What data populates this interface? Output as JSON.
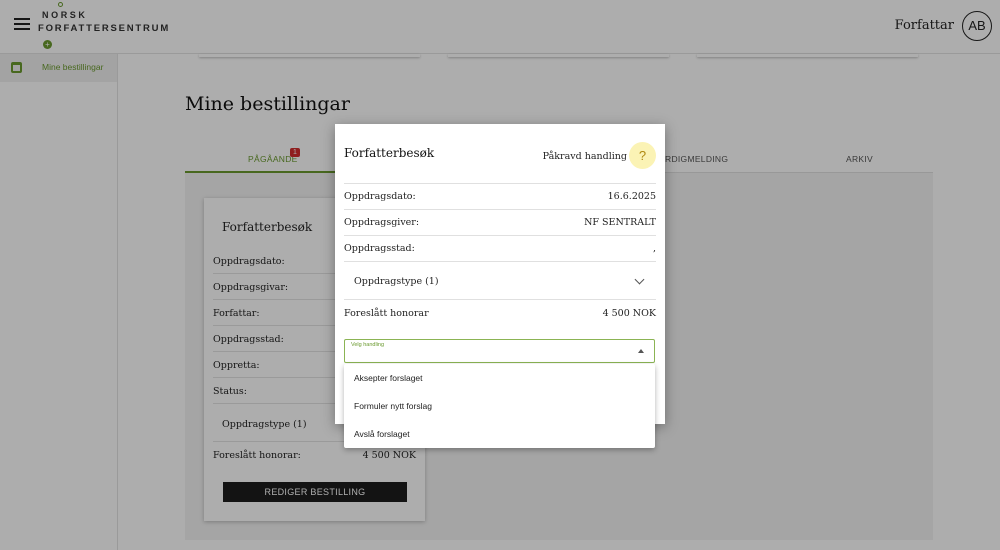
{
  "header": {
    "logo_line1": "NORSK",
    "logo_line2": "FORFATTERSENTRUM",
    "user_role": "Forfattar",
    "avatar_initials": "AB"
  },
  "sidebar": {
    "items": [
      {
        "label": "Mine bestillingar",
        "icon": "calendar-icon",
        "active": true
      }
    ]
  },
  "main": {
    "page_title": "Mine bestillingar",
    "tabs": [
      {
        "label": "PÅGÅANDE",
        "badge": "1",
        "active": true
      },
      {
        "label": "FERDIGMELDING",
        "visible_text": "RDIGMELDING"
      },
      {
        "label": "ARKIV"
      }
    ],
    "order_card": {
      "title": "Forfatterbesøk",
      "rows": [
        {
          "label": "Oppdragsdato:",
          "value": ""
        },
        {
          "label": "Oppdragsgivar:",
          "value": ""
        },
        {
          "label": "Forfattar:",
          "value": ""
        },
        {
          "label": "Oppdragsstad:",
          "value": ""
        },
        {
          "label": "Oppretta:",
          "value": ""
        },
        {
          "label": "Status:",
          "value": ""
        }
      ],
      "type_label": "Oppdragstype (1)",
      "fee_label": "Foreslått honorar:",
      "fee_value": "4 500 NOK",
      "edit_button": "REDIGER BESTILLING"
    }
  },
  "modal": {
    "title": "Forfatterbesøk",
    "status_label": "Påkravd handling",
    "status_icon": "question-icon",
    "rows": [
      {
        "label": "Oppdragsdato:",
        "value": "16.6.2025"
      },
      {
        "label": "Oppdragsgiver:",
        "value": "NF SENTRALT"
      },
      {
        "label": "Oppdragsstad:",
        "value": ","
      }
    ],
    "type_label": "Oppdragstype (1)",
    "fee_label": "Foreslått honorar",
    "fee_value": "4 500 NOK",
    "select": {
      "label": "Velg handling",
      "options": [
        "Aksepter forslaget",
        "Formuler nytt forslag",
        "Avslå forslaget"
      ]
    }
  },
  "colors": {
    "accent": "#6a9a2e",
    "badge": "#d32f2f",
    "status_bg": "#fbf3b5",
    "button_dark": "#1c1c1c"
  }
}
